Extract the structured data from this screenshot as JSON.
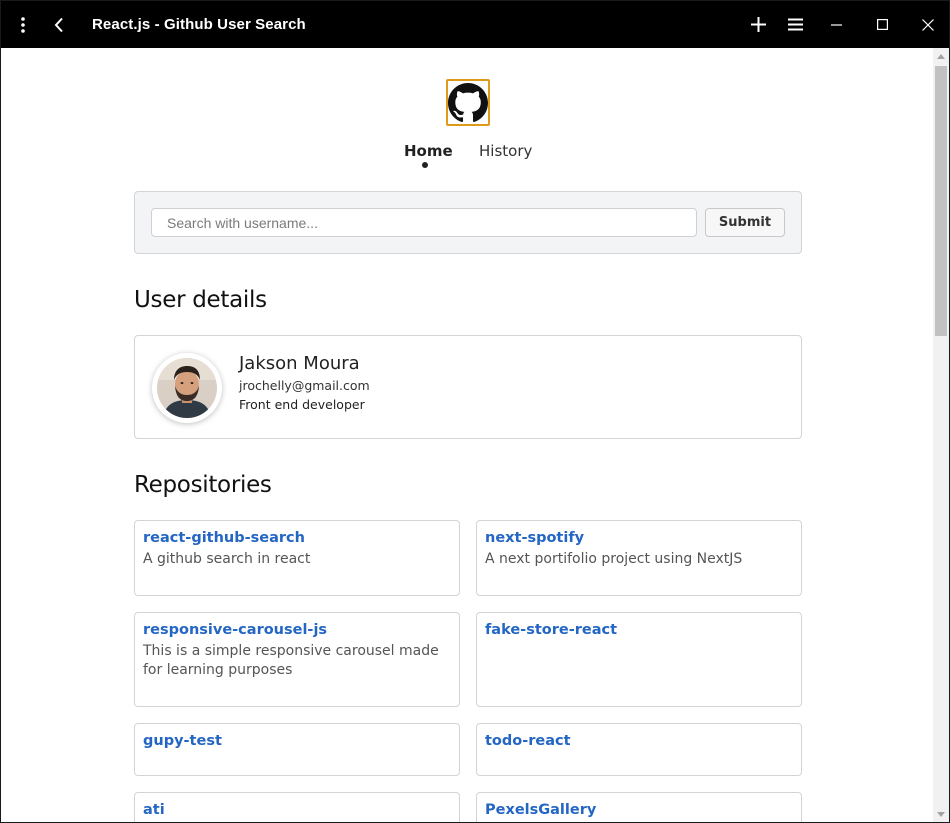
{
  "window": {
    "title": "React.js - Github User Search",
    "icons": [
      "kebab-menu-icon",
      "back-arrow-icon",
      "plus-icon",
      "hamburger-menu-icon",
      "minimize-icon",
      "maximize-icon",
      "close-icon"
    ]
  },
  "nav": {
    "home_label": "Home",
    "history_label": "History",
    "active": "Home"
  },
  "search": {
    "placeholder": "Search with username...",
    "value": "",
    "submit_label": "Submit"
  },
  "user_section": {
    "title": "User details",
    "name": "Jakson Moura",
    "email": "jrochelly@gmail.com",
    "bio": "Front end developer"
  },
  "repos_section": {
    "title": "Repositories",
    "items": [
      {
        "name": "react-github-search",
        "description": "A github search in react"
      },
      {
        "name": "next-spotify",
        "description": "A next portifolio project using NextJS"
      },
      {
        "name": "responsive-carousel-js",
        "description": "This is a simple responsive carousel made for learning purposes"
      },
      {
        "name": "fake-store-react",
        "description": ""
      },
      {
        "name": "gupy-test",
        "description": ""
      },
      {
        "name": "todo-react",
        "description": ""
      },
      {
        "name": "ati",
        "description": ""
      },
      {
        "name": "PexelsGallery",
        "description": ""
      }
    ]
  },
  "colors": {
    "titlebar": "#000000",
    "link": "#2466c4",
    "logo_border": "#e09a1a",
    "panel_bg": "#f3f4f6"
  }
}
